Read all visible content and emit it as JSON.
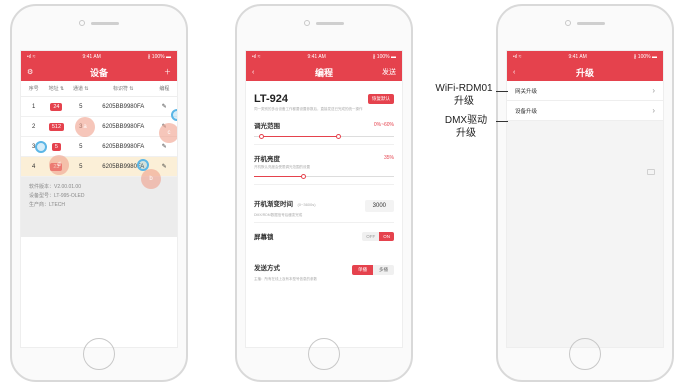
{
  "status": {
    "signal": "•ıl ≈",
    "time": "9:41 AM",
    "battery": "∦ 100% ▬"
  },
  "screen1": {
    "title": "设备",
    "headers": [
      "序号",
      "地址 ⇅",
      "通道 ⇅",
      "标识符 ⇅",
      "编程"
    ],
    "rows": [
      {
        "index": "1",
        "address": "24",
        "channel": "5",
        "identifier": "6205BB9980FA"
      },
      {
        "index": "2",
        "address": "512",
        "channel": "3",
        "identifier": "6205BB9980FA"
      },
      {
        "index": "3",
        "address": "5",
        "channel": "5",
        "identifier": "6205BB9980FA"
      },
      {
        "index": "4",
        "address": "23",
        "channel": "5",
        "identifier": "6205BB9980FA"
      }
    ],
    "info": [
      "软件版本：V2.00.01.00",
      "设备型号：LT-995-OLED",
      "生产商：LTECH"
    ],
    "markers": [
      "a",
      "b",
      "c",
      "d"
    ]
  },
  "screen2": {
    "title": "编程",
    "right": "发送",
    "model": "LT-924",
    "restore": "恢复默认",
    "hint": "同一类别的多台设备工作都要设置参数后，直接发送已完成的统一操作",
    "dim_label": "调光范围",
    "dim_value": "0%~60%",
    "bright_label": "开机亮度",
    "bright_value": "35%",
    "bright_hint": "开机默认亮度会受限调光范围的设置",
    "fade_label": "开机渐变时间",
    "fade_unit": "(0~3600s)",
    "fade_hint": "DMX/RDM数据信号后缓变完成",
    "fade_value": "3000",
    "lock_label": "屏幕锁",
    "lock_off": "OFF",
    "lock_on": "ON",
    "send_label": "发送方式",
    "send_hint": "主播：所有在线上及有本型号信息的参数",
    "send_a": "单播",
    "send_b": "多播",
    "dim_range": [
      0.05,
      0.6
    ],
    "brightness": 0.35
  },
  "screen3": {
    "title": "升级",
    "items": [
      "网关升级",
      "设备升级"
    ]
  },
  "annotations": {
    "wifi_line1": "WiFi-RDM01",
    "wifi_line2": "升级",
    "dmx_line1": "DMX驱动",
    "dmx_line2": "升级"
  }
}
